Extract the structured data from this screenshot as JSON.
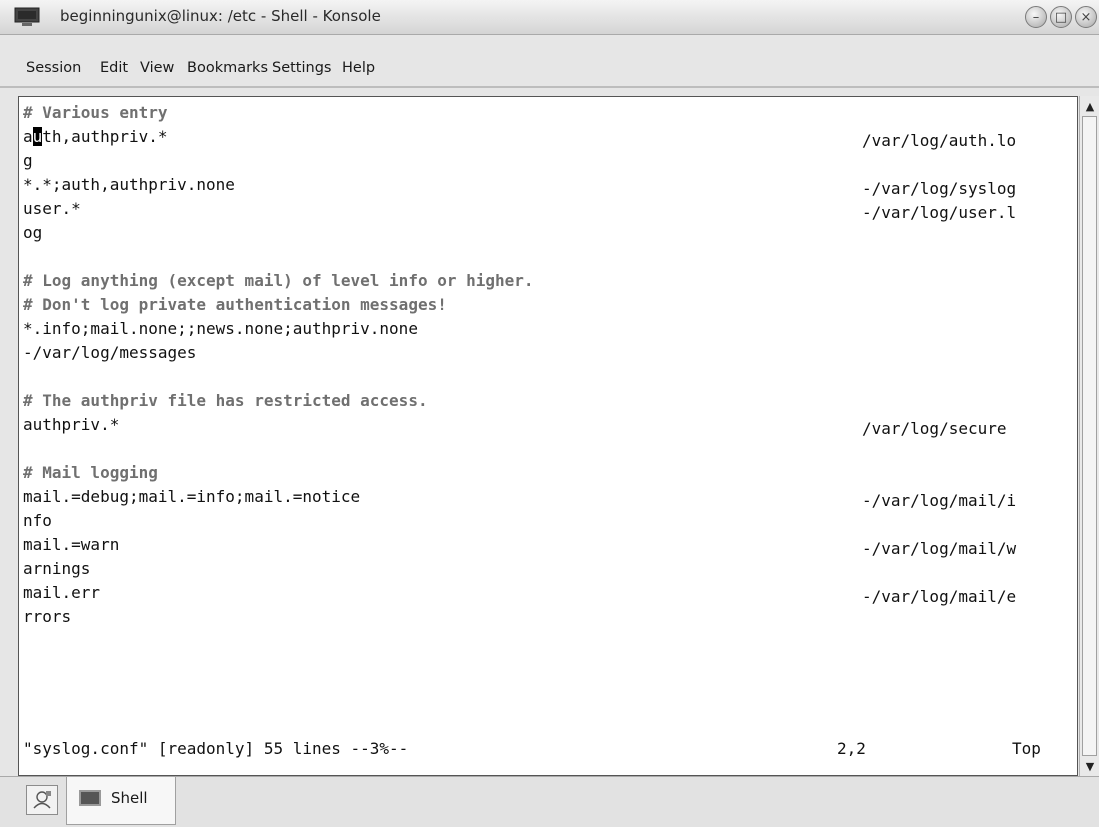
{
  "window": {
    "title": "beginningunix@linux: /etc - Shell - Konsole",
    "icon": "terminal-icon",
    "controls": [
      "minimize-icon",
      "maximize-icon",
      "close-icon"
    ]
  },
  "menu": {
    "items": [
      "Session",
      "Edit",
      "View",
      "Bookmarks",
      "Settings",
      "Help"
    ]
  },
  "terminal": {
    "cursor_char": "u",
    "lines": [
      {
        "text": "# Various entry",
        "right": ""
      },
      {
        "text": "a",
        "cursor": "u",
        "after": "th,authpriv.*",
        "right": "/var/log/auth.lo"
      },
      {
        "text": "g",
        "right": ""
      },
      {
        "text": "*.*;auth,authpriv.none",
        "right": "-/var/log/syslog"
      },
      {
        "text": "user.*",
        "right": "-/var/log/user.l"
      },
      {
        "text": "og",
        "right": ""
      },
      {
        "text": "",
        "right": ""
      },
      {
        "text": "# Log anything (except mail) of level info or higher.",
        "right": ""
      },
      {
        "text": "# Don't log private authentication messages!",
        "right": ""
      },
      {
        "text": "*.info;mail.none;;news.none;authpriv.none",
        "right": ""
      },
      {
        "text": "-/var/log/messages",
        "right": ""
      },
      {
        "text": "",
        "right": ""
      },
      {
        "text": "# The authpriv file has restricted access.",
        "right": ""
      },
      {
        "text": "authpriv.*",
        "right": "/var/log/secure"
      },
      {
        "text": "",
        "right": ""
      },
      {
        "text": "# Mail logging",
        "right": ""
      },
      {
        "text": "mail.=debug;mail.=info;mail.=notice",
        "right": "-/var/log/mail/i"
      },
      {
        "text": "nfo",
        "right": ""
      },
      {
        "text": "mail.=warn",
        "right": "-/var/log/mail/w"
      },
      {
        "text": "arnings",
        "right": ""
      },
      {
        "text": "mail.err",
        "right": "-/var/log/mail/e"
      },
      {
        "text": "rrors",
        "right": ""
      }
    ],
    "status": {
      "file": "\"syslog.conf\" [readonly] 55 lines --3%--",
      "position": "2,2",
      "scroll": "Top"
    }
  },
  "tabs": {
    "items": [
      {
        "label": "Shell"
      }
    ]
  }
}
